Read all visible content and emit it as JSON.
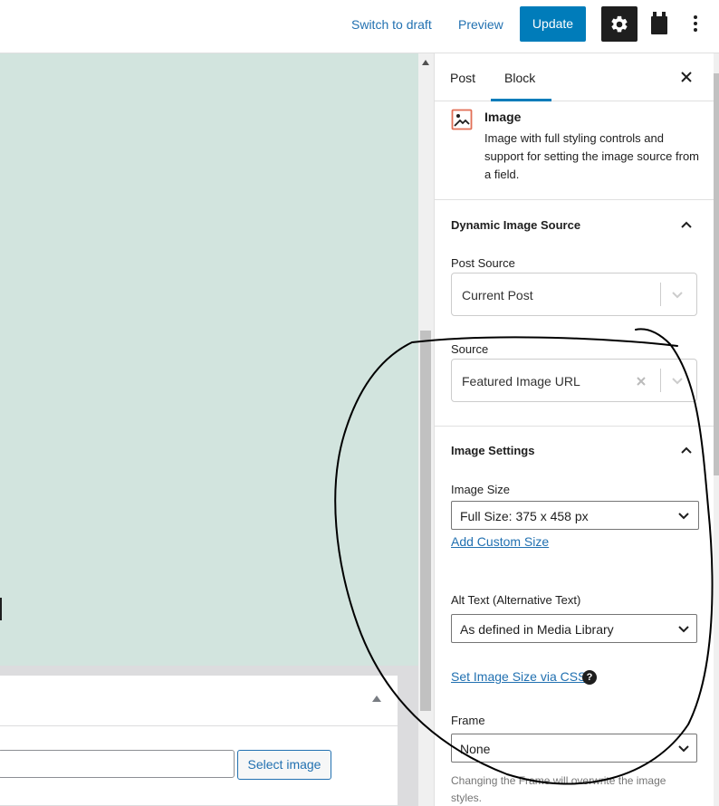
{
  "topbar": {
    "switch_to_draft": "Switch to draft",
    "preview": "Preview",
    "update": "Update"
  },
  "icons": {
    "settings": "gear-icon",
    "plugins": "plugin-icon",
    "options": "more-vertical-icon"
  },
  "colors": {
    "accent": "#007cba",
    "link": "#2271b1",
    "canvas_image": "#d2e4de",
    "dark": "#1e1e1e"
  },
  "canvas": {
    "meta_button": "Select image"
  },
  "sidebar": {
    "tabs": [
      {
        "label": "Post",
        "active": false
      },
      {
        "label": "Block",
        "active": true
      }
    ],
    "block": {
      "title": "Image",
      "description": "Image with full styling controls and support for setting the image source from a field."
    },
    "dynamic_source": {
      "title": "Dynamic Image Source",
      "post_source_label": "Post Source",
      "post_source_value": "Current Post",
      "source_label": "Source",
      "source_value": "Featured Image URL"
    },
    "image_settings": {
      "title": "Image Settings",
      "size_label": "Image Size",
      "size_value": "Full Size: 375 x 458 px",
      "add_custom_size": "Add Custom Size",
      "alt_label": "Alt Text (Alternative Text)",
      "alt_value": "As defined in Media Library",
      "css_size_link": "Set Image Size via CSS",
      "help": "?",
      "frame_label": "Frame",
      "frame_value": "None",
      "frame_help": "Changing the Frame will overwrite the image styles."
    }
  }
}
